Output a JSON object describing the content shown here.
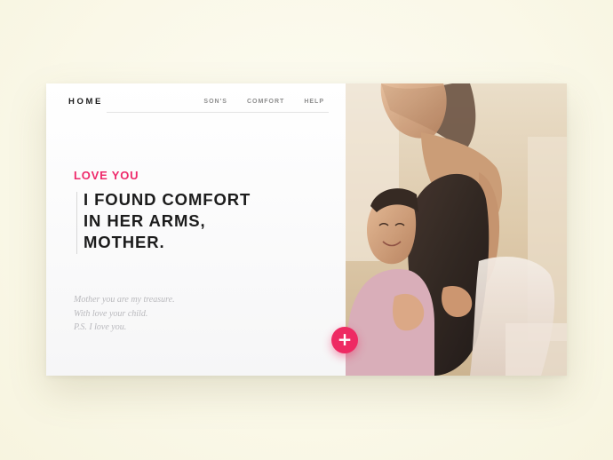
{
  "header": {
    "brand": "HOME",
    "nav": [
      {
        "label": "SON'S"
      },
      {
        "label": "COMFORT"
      },
      {
        "label": "HELP"
      }
    ]
  },
  "hero": {
    "eyebrow": "LOVE YOU",
    "headline_lines": [
      "I FOUND COMFORT",
      "IN HER ARMS,",
      "MOTHER."
    ],
    "note_lines": [
      "Mother you are my treasure.",
      "With love your child.",
      "P.S. I love you."
    ]
  },
  "media": {
    "alt": "mother hugging daughter photo"
  },
  "fab": {
    "icon": "plus-icon",
    "symbol": "+"
  },
  "colors": {
    "accent": "#ee2a63",
    "page_background": "#fbf9ea",
    "headline": "#1c1c1c",
    "muted_text": "#b9b9bd"
  }
}
